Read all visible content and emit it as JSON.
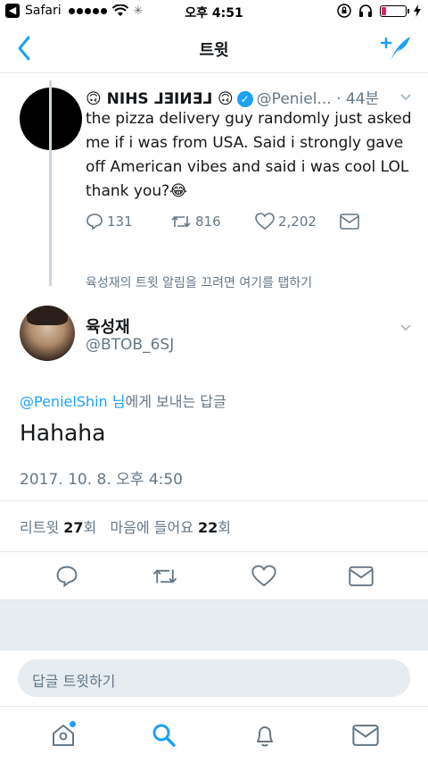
{
  "statusbar": {
    "carrier": "Safari",
    "time": "오후 4:51"
  },
  "nav": {
    "title": "트윗"
  },
  "original_tweet": {
    "display_name": "🙃 NIHS ⅃ƎIИƎ⅃ 🙃",
    "handle_time": "@Peniel... · 44분",
    "text": "the pizza delivery guy randomly just asked me if i was from USA. Said i strongly gave off American vibes and said i was cool LOL thank you?😂",
    "reply_count": "131",
    "retweet_count": "816",
    "like_count": "2,202"
  },
  "mute_note": "육성재의 트윗 알림을 끄려면 여기를 탭하기",
  "reply": {
    "display_name": "육성재",
    "handle": "@BTOB_6SJ",
    "reply_to_mention": "@PenielShin 님",
    "reply_to_suffix": "에게 보내는 답글",
    "text": "Hahaha",
    "timestamp": "2017. 10. 8. 오후 4:50"
  },
  "stats": {
    "retweet_label": "리트윗",
    "retweet_count": "27",
    "retweet_unit": "회",
    "like_label": "마음에 들어요",
    "like_count": "22",
    "like_unit": "회"
  },
  "reply_box": {
    "placeholder": "답글 트윗하기"
  },
  "colors": {
    "accent": "#1da1f2",
    "muted": "#657786",
    "separator": "#e1e8ed"
  }
}
